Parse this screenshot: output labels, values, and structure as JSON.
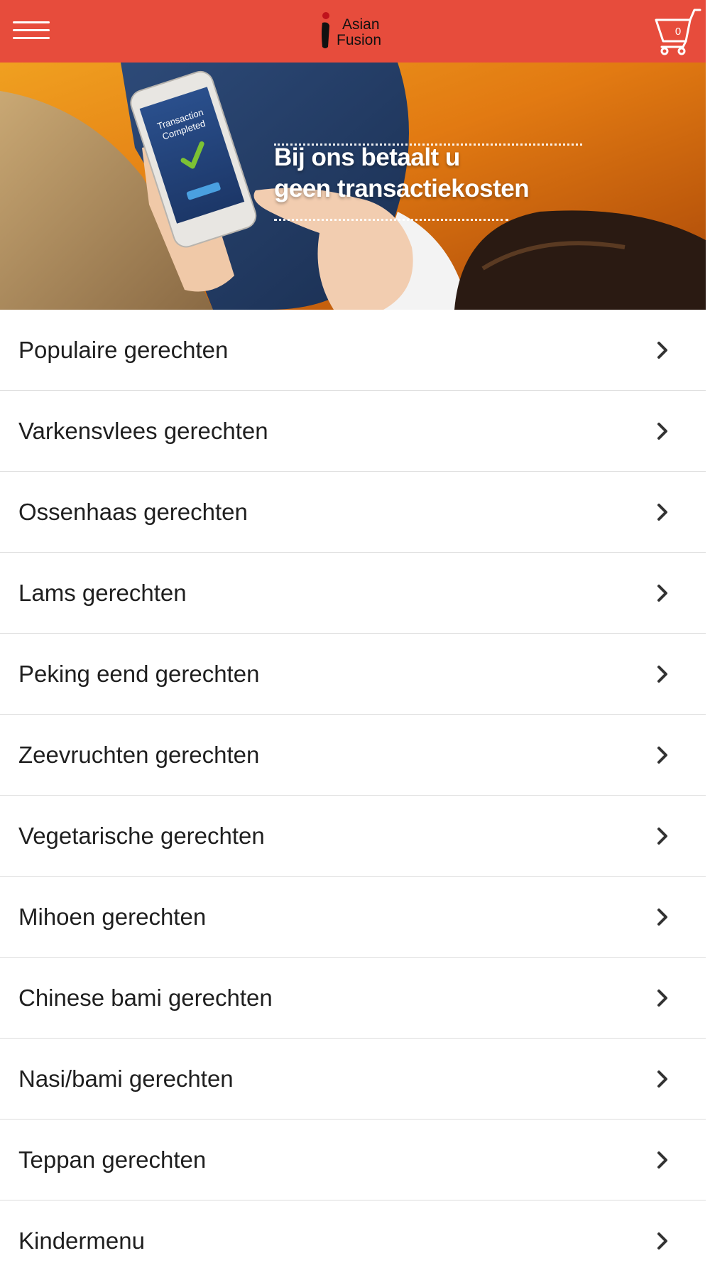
{
  "header": {
    "menu_icon": "hamburger-menu-icon",
    "logo_line1": "Asian",
    "logo_line2": "Fusion",
    "brand_color": "#e74c3c",
    "cart_icon": "shopping-cart-icon",
    "cart_count": "0"
  },
  "banner": {
    "headline_line1": "Bij ons betaalt u",
    "headline_line2": "geen transactiekosten",
    "phone_line1": "Transaction",
    "phone_line2": "Completed"
  },
  "categories": [
    {
      "label": "Populaire gerechten"
    },
    {
      "label": "Varkensvlees gerechten"
    },
    {
      "label": "Ossenhaas gerechten"
    },
    {
      "label": "Lams gerechten"
    },
    {
      "label": "Peking eend gerechten"
    },
    {
      "label": "Zeevruchten gerechten"
    },
    {
      "label": "Vegetarische gerechten"
    },
    {
      "label": "Mihoen gerechten"
    },
    {
      "label": "Chinese bami gerechten"
    },
    {
      "label": "Nasi/bami gerechten"
    },
    {
      "label": "Teppan gerechten"
    },
    {
      "label": "Kindermenu"
    }
  ],
  "chevron_icon": "chevron-right-icon"
}
